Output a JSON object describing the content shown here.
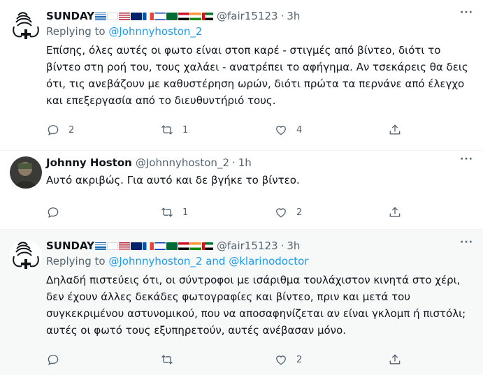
{
  "tweets": [
    {
      "name": "SUNDAY",
      "handle": "@fair15123",
      "dot": "·",
      "time": "3h",
      "replying_prefix": "Replying to ",
      "replying_to": "@Johnnyhoston_2",
      "replying_and": "",
      "replying_to_2": "",
      "text": "Επίσης, όλες αυτές οι φωτο είναι στοπ καρέ - στιγμές από βίντεο, διότι το βίντεο στη ροή του, τους χαλάει - ανατρέπει το αφήγημα. Αν τσεκάρεις θα δεις ότι, τις ανεβάζουν με καθυστέρηση ωρών, διότι πρώτα τα περνάνε από έλεγχο και επεξεργασία από το διευθυντήριό τους.",
      "reply_count": "2",
      "retweet_count": "1",
      "like_count": "4"
    },
    {
      "name": "Johnny Hoston",
      "handle": "@Johnnyhoston_2",
      "dot": "·",
      "time": "1h",
      "text": "Αυτό ακριβώς. Για αυτό και δε βγήκε το βίντεο.",
      "reply_count": "",
      "retweet_count": "1",
      "like_count": "2"
    },
    {
      "name": "SUNDAY",
      "handle": "@fair15123",
      "dot": "·",
      "time": "3h",
      "replying_prefix": "Replying to ",
      "replying_to": "@Johnnyhoston_2",
      "replying_and": " and ",
      "replying_to_2": "@klarinodoctor",
      "text": "Δηλαδή πιστεύεις ότι, οι σύντροφοι με ισάριθμα τουλάχιστον κινητά στο χέρι, δεν έχουν άλλες δεκάδες φωτογραφίες και βίντεο, πριν και μετά του συγκεκριμένου αστυνομικού, που να αποσαφηνίζεται αν είναι γκλομπ ή πιστόλι; αυτές οι φωτό τους εξυπηρετούν, αυτές ανέβασαν μόνο.",
      "reply_count": "",
      "retweet_count": "",
      "like_count": "2"
    }
  ],
  "flag_names": [
    "greece-flag",
    "cyprus-flag",
    "usa-flag",
    "uk-flag",
    "france-flag",
    "israel-flag",
    "saudi-flag",
    "egypt-flag",
    "india-flag",
    "uae-flag"
  ],
  "more_label": "···",
  "colors": {
    "link": "#1d9bf0",
    "muted": "#536471",
    "text": "#0f1419",
    "highlight_bg": "#f7f9f9"
  },
  "icons": [
    "reply-icon",
    "retweet-icon",
    "like-icon",
    "share-icon",
    "more-icon"
  ]
}
